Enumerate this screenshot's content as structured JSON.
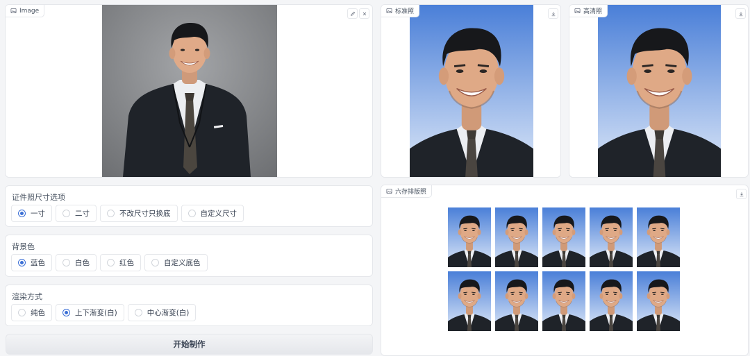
{
  "image_panel": {
    "label": "Image",
    "icon": "image-icon",
    "edit_icon": "pencil-icon",
    "close_icon": "close-icon"
  },
  "standard_panel": {
    "label": "标准照",
    "icon": "image-icon",
    "download_icon": "download-icon"
  },
  "hd_panel": {
    "label": "高清照",
    "icon": "image-icon",
    "download_icon": "download-icon"
  },
  "layout_panel": {
    "label": "六存排版照",
    "icon": "image-icon",
    "download_icon": "download-icon"
  },
  "size_group": {
    "title": "证件照尺寸选项",
    "options": [
      {
        "label": "一寸",
        "selected": true
      },
      {
        "label": "二寸",
        "selected": false
      },
      {
        "label": "不改尺寸只换底",
        "selected": false
      },
      {
        "label": "自定义尺寸",
        "selected": false
      }
    ]
  },
  "bg_group": {
    "title": "背景色",
    "options": [
      {
        "label": "蓝色",
        "selected": true
      },
      {
        "label": "白色",
        "selected": false
      },
      {
        "label": "红色",
        "selected": false
      },
      {
        "label": "自定义底色",
        "selected": false
      }
    ]
  },
  "render_group": {
    "title": "渲染方式",
    "options": [
      {
        "label": "纯色",
        "selected": false
      },
      {
        "label": "上下渐变(白)",
        "selected": true
      },
      {
        "label": "中心渐变(白)",
        "selected": false
      }
    ]
  },
  "start_button": {
    "label": "开始制作"
  },
  "colors": {
    "accent": "#3b6fd6",
    "id_background_top": "#4a7fd8",
    "id_background_bottom": "#dfe9f8",
    "suit": "#1f2329"
  }
}
